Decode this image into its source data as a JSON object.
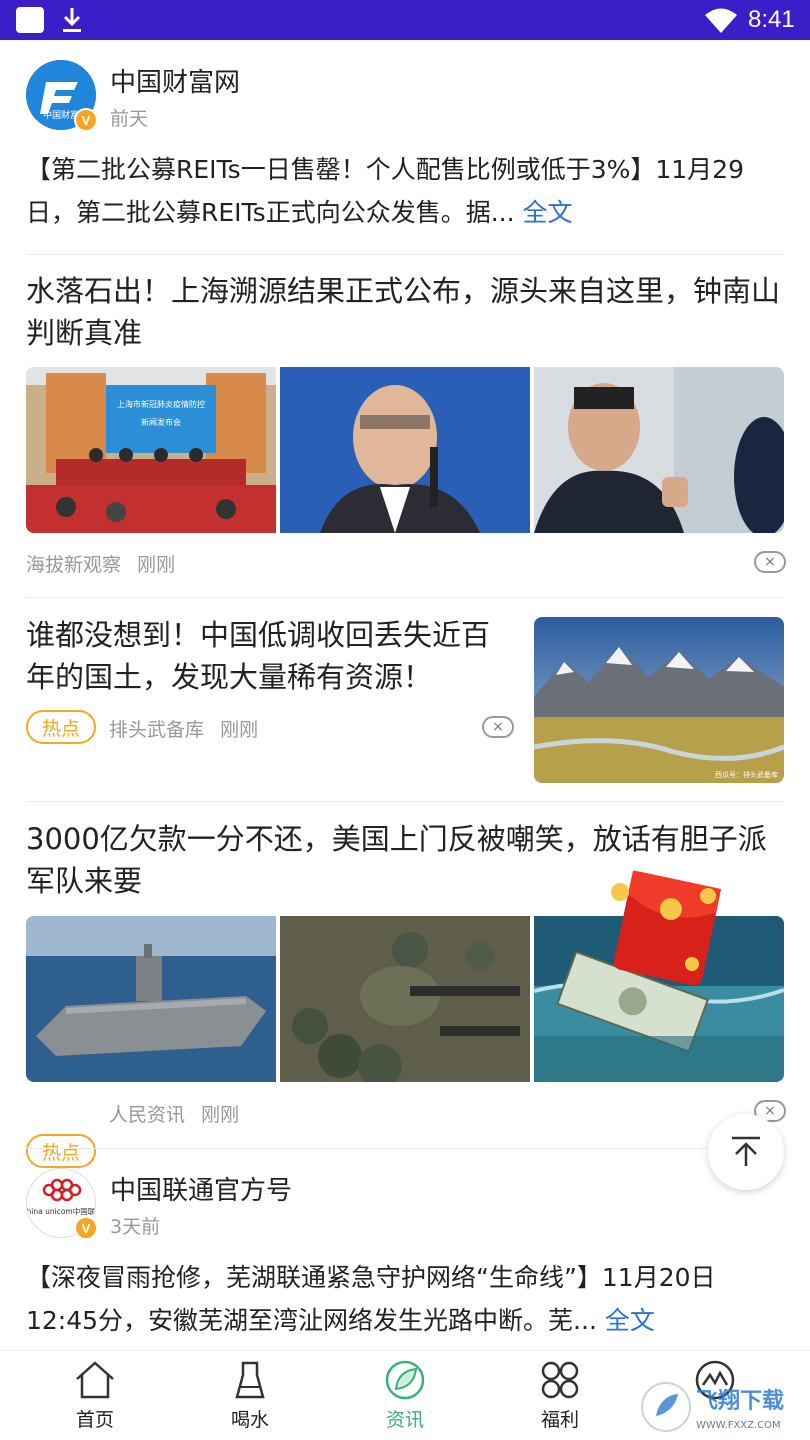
{
  "status_bar": {
    "time": "8:41"
  },
  "feed": {
    "post1": {
      "author": "中国财富网",
      "avatar_logo_text": "中国财富",
      "verified_badge": "V",
      "ago": "前天",
      "text": "【第二批公募REITs一日售罄！个人配售比例或低于3%】11月29日，第二批公募REITs正式向公众发售。据...",
      "full_text_link": "全文"
    },
    "article1": {
      "title": "水落石出！上海溯源结果正式公布，源头来自这里，钟南山判断真准",
      "banner_text_1": "上海市新冠肺炎疫情防控",
      "banner_text_2": "新闻发布会",
      "source": "海拔新观察",
      "time": "刚刚",
      "close_icon": "×"
    },
    "article2": {
      "title": "谁都没想到！中国低调收回丢失近百年的国土，发现大量稀有资源！",
      "tag": "热点",
      "source": "排头武备库",
      "time": "刚刚",
      "close_icon": "×",
      "image_credit": "西瓜号：排头武备库"
    },
    "article3": {
      "title": "3000亿欠款一分不还，美国上门反被嘲笑，放话有胆子派军队来要",
      "tag": "热点",
      "source": "人民资讯",
      "time": "刚刚",
      "close_icon": "×"
    },
    "post2": {
      "author": "中国联通官方号",
      "avatar_logo_text": "China unicom中国联通",
      "verified_badge": "V",
      "ago": "3天前",
      "text": "【深夜冒雨抢修，芜湖联通紧急守护网络“生命线”】11月20日12:45分，安徽芜湖至湾沚网络发生光路中断。芜...",
      "full_text_link": "全文"
    }
  },
  "tabbar": {
    "tabs": [
      {
        "label": "首页",
        "icon": "home-icon"
      },
      {
        "label": "喝水",
        "icon": "water-cup-icon"
      },
      {
        "label": "资讯",
        "icon": "news-leaf-icon",
        "active": true
      },
      {
        "label": "福利",
        "icon": "grid-icon"
      },
      {
        "label": "",
        "icon": "profile-icon"
      }
    ]
  },
  "watermark": {
    "text": "飞翔下载",
    "url_text": "WWW.FXXZ.COM"
  },
  "colors": {
    "status_bar": "#3a1ec8",
    "accent_link": "#2d6fd6",
    "hot_tag": "#f5a623",
    "active_tab": "#3bb07a"
  }
}
